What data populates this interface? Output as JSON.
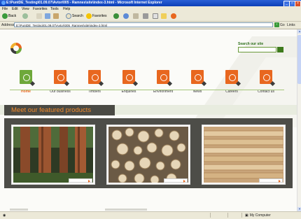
{
  "window": {
    "title": "E:\\PuntDE_Testing\\01.09.07\\Avtor\\005 - Ramnes\\site\\index-3.html - Microsoft Internet Explorer",
    "min_glyph": "_",
    "max_glyph": "□",
    "close_glyph": "×"
  },
  "menu": [
    "File",
    "Edit",
    "View",
    "Favorites",
    "Tools",
    "Help"
  ],
  "toolbar": {
    "back_label": "Back",
    "search_label": "Search",
    "favorites_label": "Favorites"
  },
  "address": {
    "label": "Address",
    "value": "E:\\PuntDE_Testing\\01.09.07\\Avtor\\005_Ramnes\\site\\index-3.html",
    "go_label": "Go",
    "links_label": "Links"
  },
  "site": {
    "search_label": "Search our site",
    "nav": [
      {
        "label": "Home",
        "active": true
      },
      {
        "label": "Our business",
        "active": false
      },
      {
        "label": "Timbers",
        "active": false
      },
      {
        "label": "Enquiries",
        "active": false
      },
      {
        "label": "Environment",
        "active": false
      },
      {
        "label": "News",
        "active": false
      },
      {
        "label": "Careers",
        "active": false
      },
      {
        "label": "Contact us",
        "active": false
      }
    ],
    "featured_title": "Meet our featured products",
    "colors": {
      "accent": "#e8671f",
      "brand_green": "#3d7a1c",
      "panel": "#4d4d48"
    }
  },
  "status": {
    "zone_label": "My Computer"
  }
}
